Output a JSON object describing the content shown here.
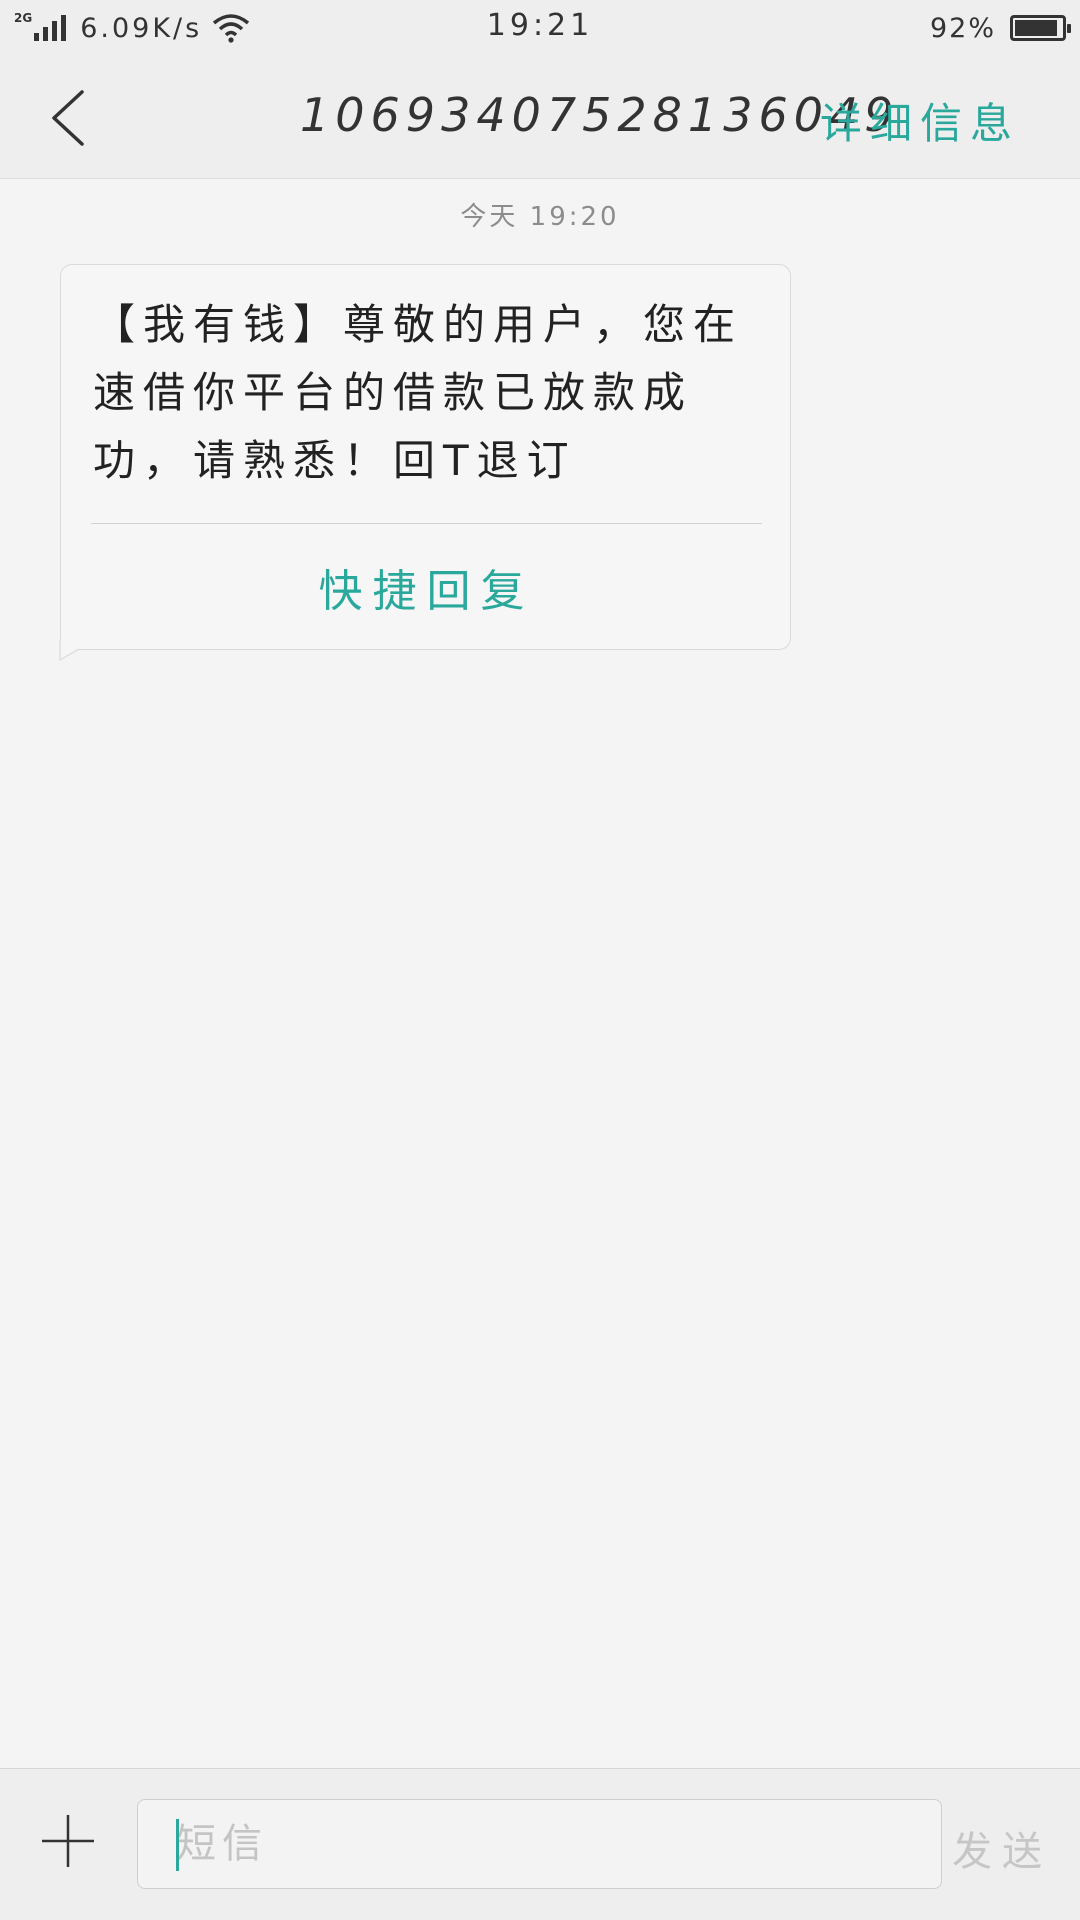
{
  "status_bar": {
    "network": "2G",
    "speed": "6.09K/s",
    "time": "19:21",
    "battery_percent": "92%",
    "battery_level": 0.92
  },
  "header": {
    "title": "10693407528136049",
    "details_label": "详细信息"
  },
  "conversation": {
    "timestamp": "今天 19:20",
    "messages": [
      {
        "text": "【我有钱】尊敬的用户，您在速借你平台的借款已放款成功，请熟悉！回T退订",
        "quick_reply_label": "快捷回复"
      }
    ]
  },
  "composer": {
    "placeholder": "短信",
    "send_label": "发送"
  },
  "colors": {
    "accent": "#2aa89c",
    "background": "#f4f4f4",
    "bar": "#eeeeee"
  },
  "icons": [
    "signal-icon",
    "wifi-icon",
    "battery-icon",
    "back-arrow-icon",
    "plus-icon"
  ]
}
